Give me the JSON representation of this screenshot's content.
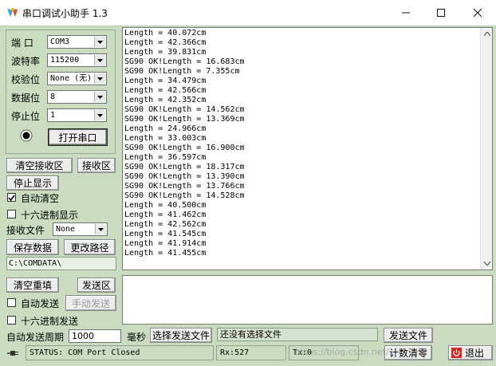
{
  "window": {
    "title": "串口调试小助手 1.3",
    "icon": "app-logo-icon",
    "controls": {
      "minimize": "–",
      "maximize": "☐",
      "close": "✕"
    }
  },
  "settings": {
    "port_label": "端  口",
    "port_value": "COM3",
    "baud_label": "波特率",
    "baud_value": "115200",
    "parity_label": "校验位",
    "parity_value": "None (无)",
    "databits_label": "数据位",
    "databits_value": "8",
    "stopbits_label": "停止位",
    "stopbits_value": "1",
    "open_port_button": "打开串口"
  },
  "receive": {
    "clear_button": "清空接收区",
    "area_button": "接收区",
    "stop_display_button": "停止显示",
    "auto_clear_label": "自动清空",
    "auto_clear_checked": true,
    "hex_display_label": "十六进制显示",
    "hex_display_checked": false,
    "file_label": "接收文件",
    "file_mode": "None",
    "save_button": "保存数据",
    "change_path_button": "更改路径",
    "path": "C:\\COMDATA\\",
    "lines": [
      "Length = 40.072cm",
      "Length = 42.366cm",
      "Length = 39.831cm",
      "SG90 OK!Length = 16.683cm",
      "SG90 OK!Length = 7.355cm",
      "Length = 34.479cm",
      "Length = 42.566cm",
      "Length = 42.352cm",
      "SG90 OK!Length = 14.562cm",
      "SG90 OK!Length = 13.369cm",
      "Length = 24.966cm",
      "Length = 33.003cm",
      "SG90 OK!Length = 16.900cm",
      "Length = 36.597cm",
      "SG90 OK!Length = 18.317cm",
      "SG90 OK!Length = 13.390cm",
      "SG90 OK!Length = 13.766cm",
      "SG90 OK!Length = 14.528cm",
      "Length = 40.500cm",
      "Length = 41.462cm",
      "Length = 42.562cm",
      "Length = 41.545cm",
      "Length = 41.914cm",
      "Length = 41.455cm"
    ]
  },
  "send": {
    "clear_button": "清空重填",
    "area_button": "发送区",
    "auto_send_label": "自动发送",
    "auto_send_checked": false,
    "manual_send_button": "手动发送",
    "hex_send_label": "十六进制发送",
    "hex_send_checked": false,
    "period_label": "自动发送周期",
    "period_value": "1000",
    "period_unit": "毫秒",
    "select_file_button": "选择发送文件",
    "no_file_text": "还没有选择文件",
    "send_file_button": "发送文件"
  },
  "status": {
    "status_text": "STATUS: COM Port Closed",
    "rx": "Rx:527",
    "tx": "Tx:0",
    "reset_count_button": "计数清零",
    "exit_button": "退出",
    "watermark": "https://blog.csdn.net/..."
  }
}
